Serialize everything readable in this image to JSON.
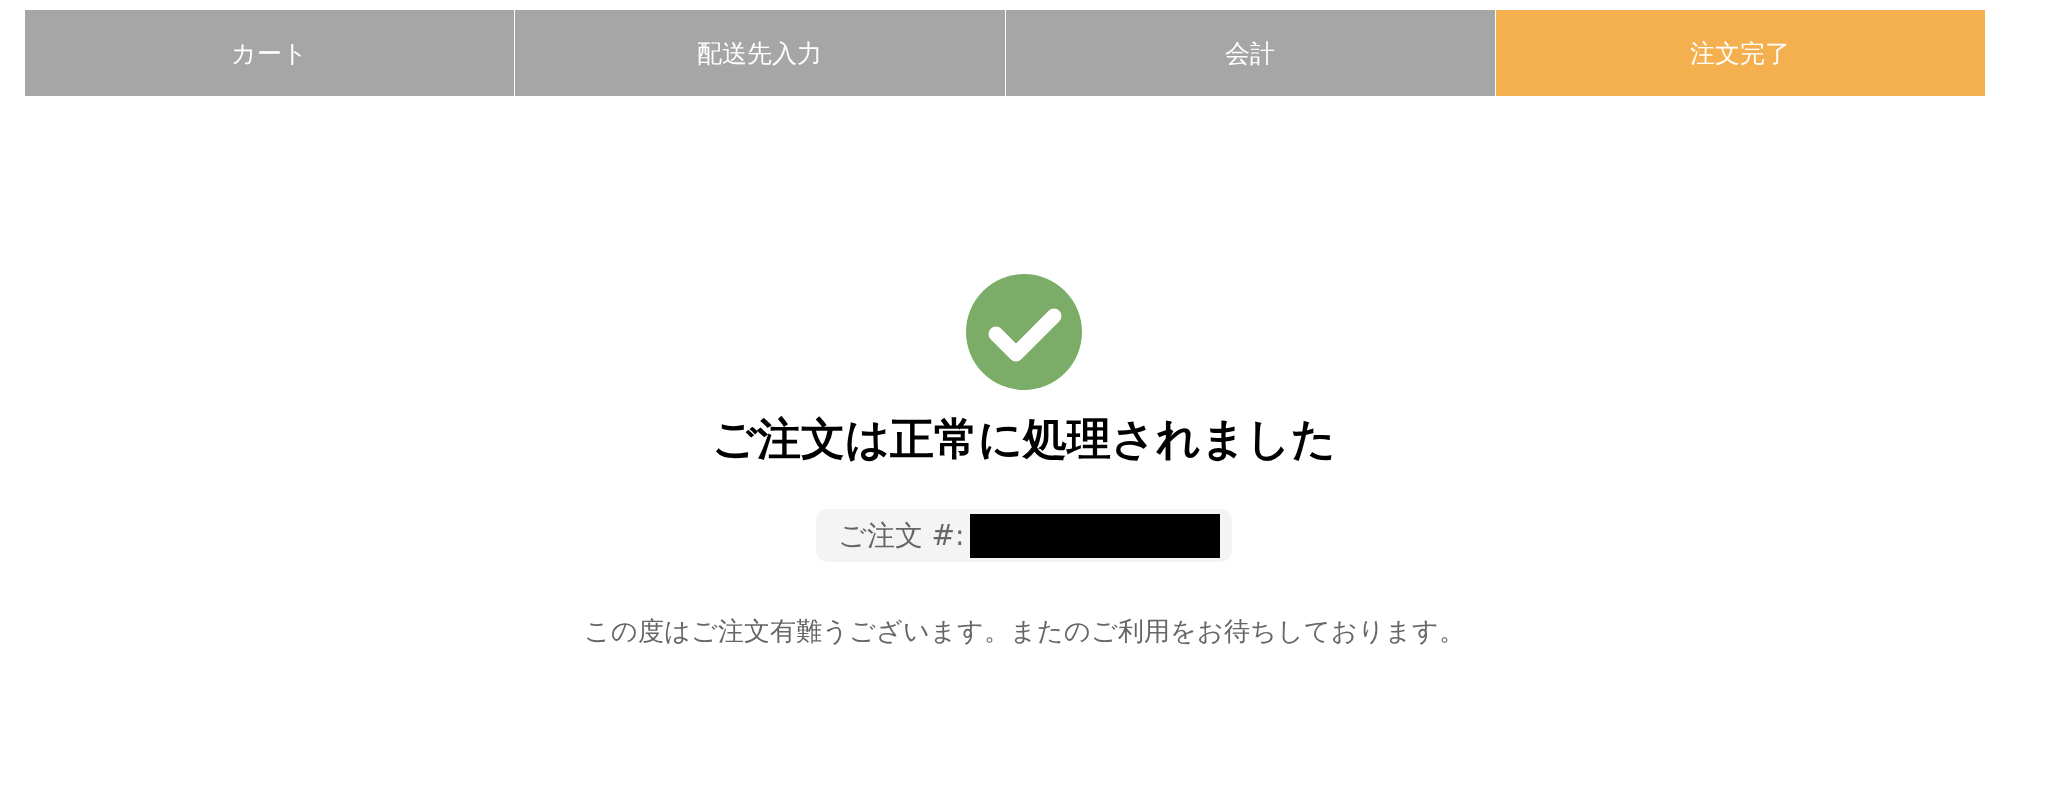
{
  "steps": [
    {
      "label": "カート",
      "selected": false
    },
    {
      "label": "配送先入力",
      "selected": false
    },
    {
      "label": "会計",
      "selected": false
    },
    {
      "label": "注文完了",
      "selected": true
    }
  ],
  "heading": "ご注文は正常に処理されました",
  "order_label": "ご注文 #:",
  "message": "この度はご注文有難うございます。またのご利用をお待ちしております。"
}
